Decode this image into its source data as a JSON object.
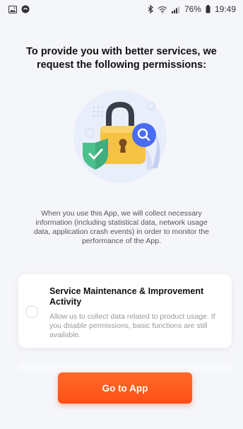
{
  "status_bar": {
    "battery": "76%",
    "time": "19:49",
    "icons": [
      "image-icon",
      "shield-app-icon",
      "bluetooth-icon",
      "wifi-icon",
      "signal-icon",
      "battery-icon"
    ]
  },
  "title": "To provide you with better services, we request the following permissions:",
  "illustration": {
    "icons": [
      "padlock-icon",
      "shield-check-icon",
      "magnifier-icon"
    ],
    "colors": {
      "lock": "#f6c244",
      "shackle": "#3a3d4a",
      "shield": "#4cc08c",
      "magnifier": "#4a6cf2",
      "circle": "#e9eefb"
    }
  },
  "description": "When you use this App, we will collect necessary information (including statistical data, network usage data, application crash events) in order to monitor the performance of the App.",
  "permission_card": {
    "title": "Service Maintenance & Improvement Activity",
    "text": "Allow us to collect data related to product usage. If you disable permissions, basic functions are still available.",
    "checked": false
  },
  "go_button_label": "Go to App",
  "colors": {
    "accent": "#ff5a1f",
    "background": "#f5f6fa"
  }
}
